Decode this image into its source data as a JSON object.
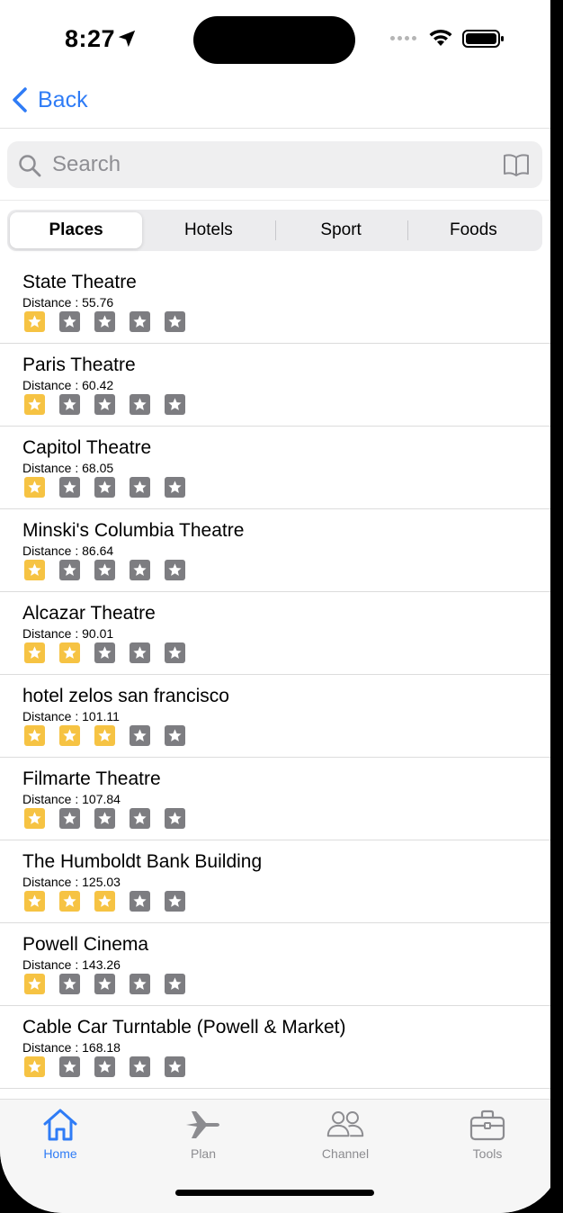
{
  "status_bar": {
    "time": "8:27"
  },
  "nav": {
    "back_label": "Back"
  },
  "search": {
    "placeholder": "Search"
  },
  "segments": [
    {
      "label": "Places",
      "active": true
    },
    {
      "label": "Hotels",
      "active": false
    },
    {
      "label": "Sport",
      "active": false
    },
    {
      "label": "Foods",
      "active": false
    }
  ],
  "places": [
    {
      "name": "State Theatre",
      "distance": "Distance : 55.76",
      "rating": 1
    },
    {
      "name": "Paris Theatre",
      "distance": "Distance : 60.42",
      "rating": 1
    },
    {
      "name": "Capitol Theatre",
      "distance": "Distance : 68.05",
      "rating": 1
    },
    {
      "name": "Minski's Columbia Theatre",
      "distance": "Distance : 86.64",
      "rating": 1
    },
    {
      "name": "Alcazar Theatre",
      "distance": "Distance : 90.01",
      "rating": 2
    },
    {
      "name": "hotel zelos san francisco",
      "distance": "Distance : 101.11",
      "rating": 3
    },
    {
      "name": "Filmarte Theatre",
      "distance": "Distance : 107.84",
      "rating": 1
    },
    {
      "name": "The Humboldt Bank Building",
      "distance": "Distance : 125.03",
      "rating": 3
    },
    {
      "name": "Powell Cinema",
      "distance": "Distance : 143.26",
      "rating": 1
    },
    {
      "name": "Cable Car Turntable (Powell & Market)",
      "distance": "Distance : 168.18",
      "rating": 1
    }
  ],
  "rating_max": 5,
  "tabbar": {
    "home": "Home",
    "plan": "Plan",
    "channel": "Channel",
    "tools": "Tools",
    "active": "home"
  },
  "colors": {
    "accent": "#2f7cf6",
    "star_on": "#f6c343",
    "star_off": "#7d7d81"
  }
}
